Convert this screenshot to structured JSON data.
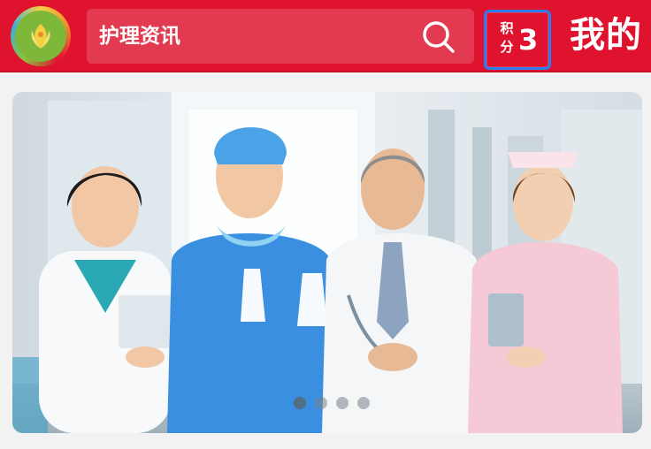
{
  "header": {
    "logo_icon": "association-logo-icon",
    "search_placeholder": "护理资讯",
    "search_icon": "search-icon",
    "points_label": "积分",
    "points_value": "3",
    "mine_label": "我的"
  },
  "banner": {
    "image": "medical-staff-photo",
    "slide_count": 4,
    "active_slide": 1
  },
  "colors": {
    "header_red": "#e0132f",
    "search_bg": "#e23a51",
    "points_border": "#2c7bf0"
  }
}
